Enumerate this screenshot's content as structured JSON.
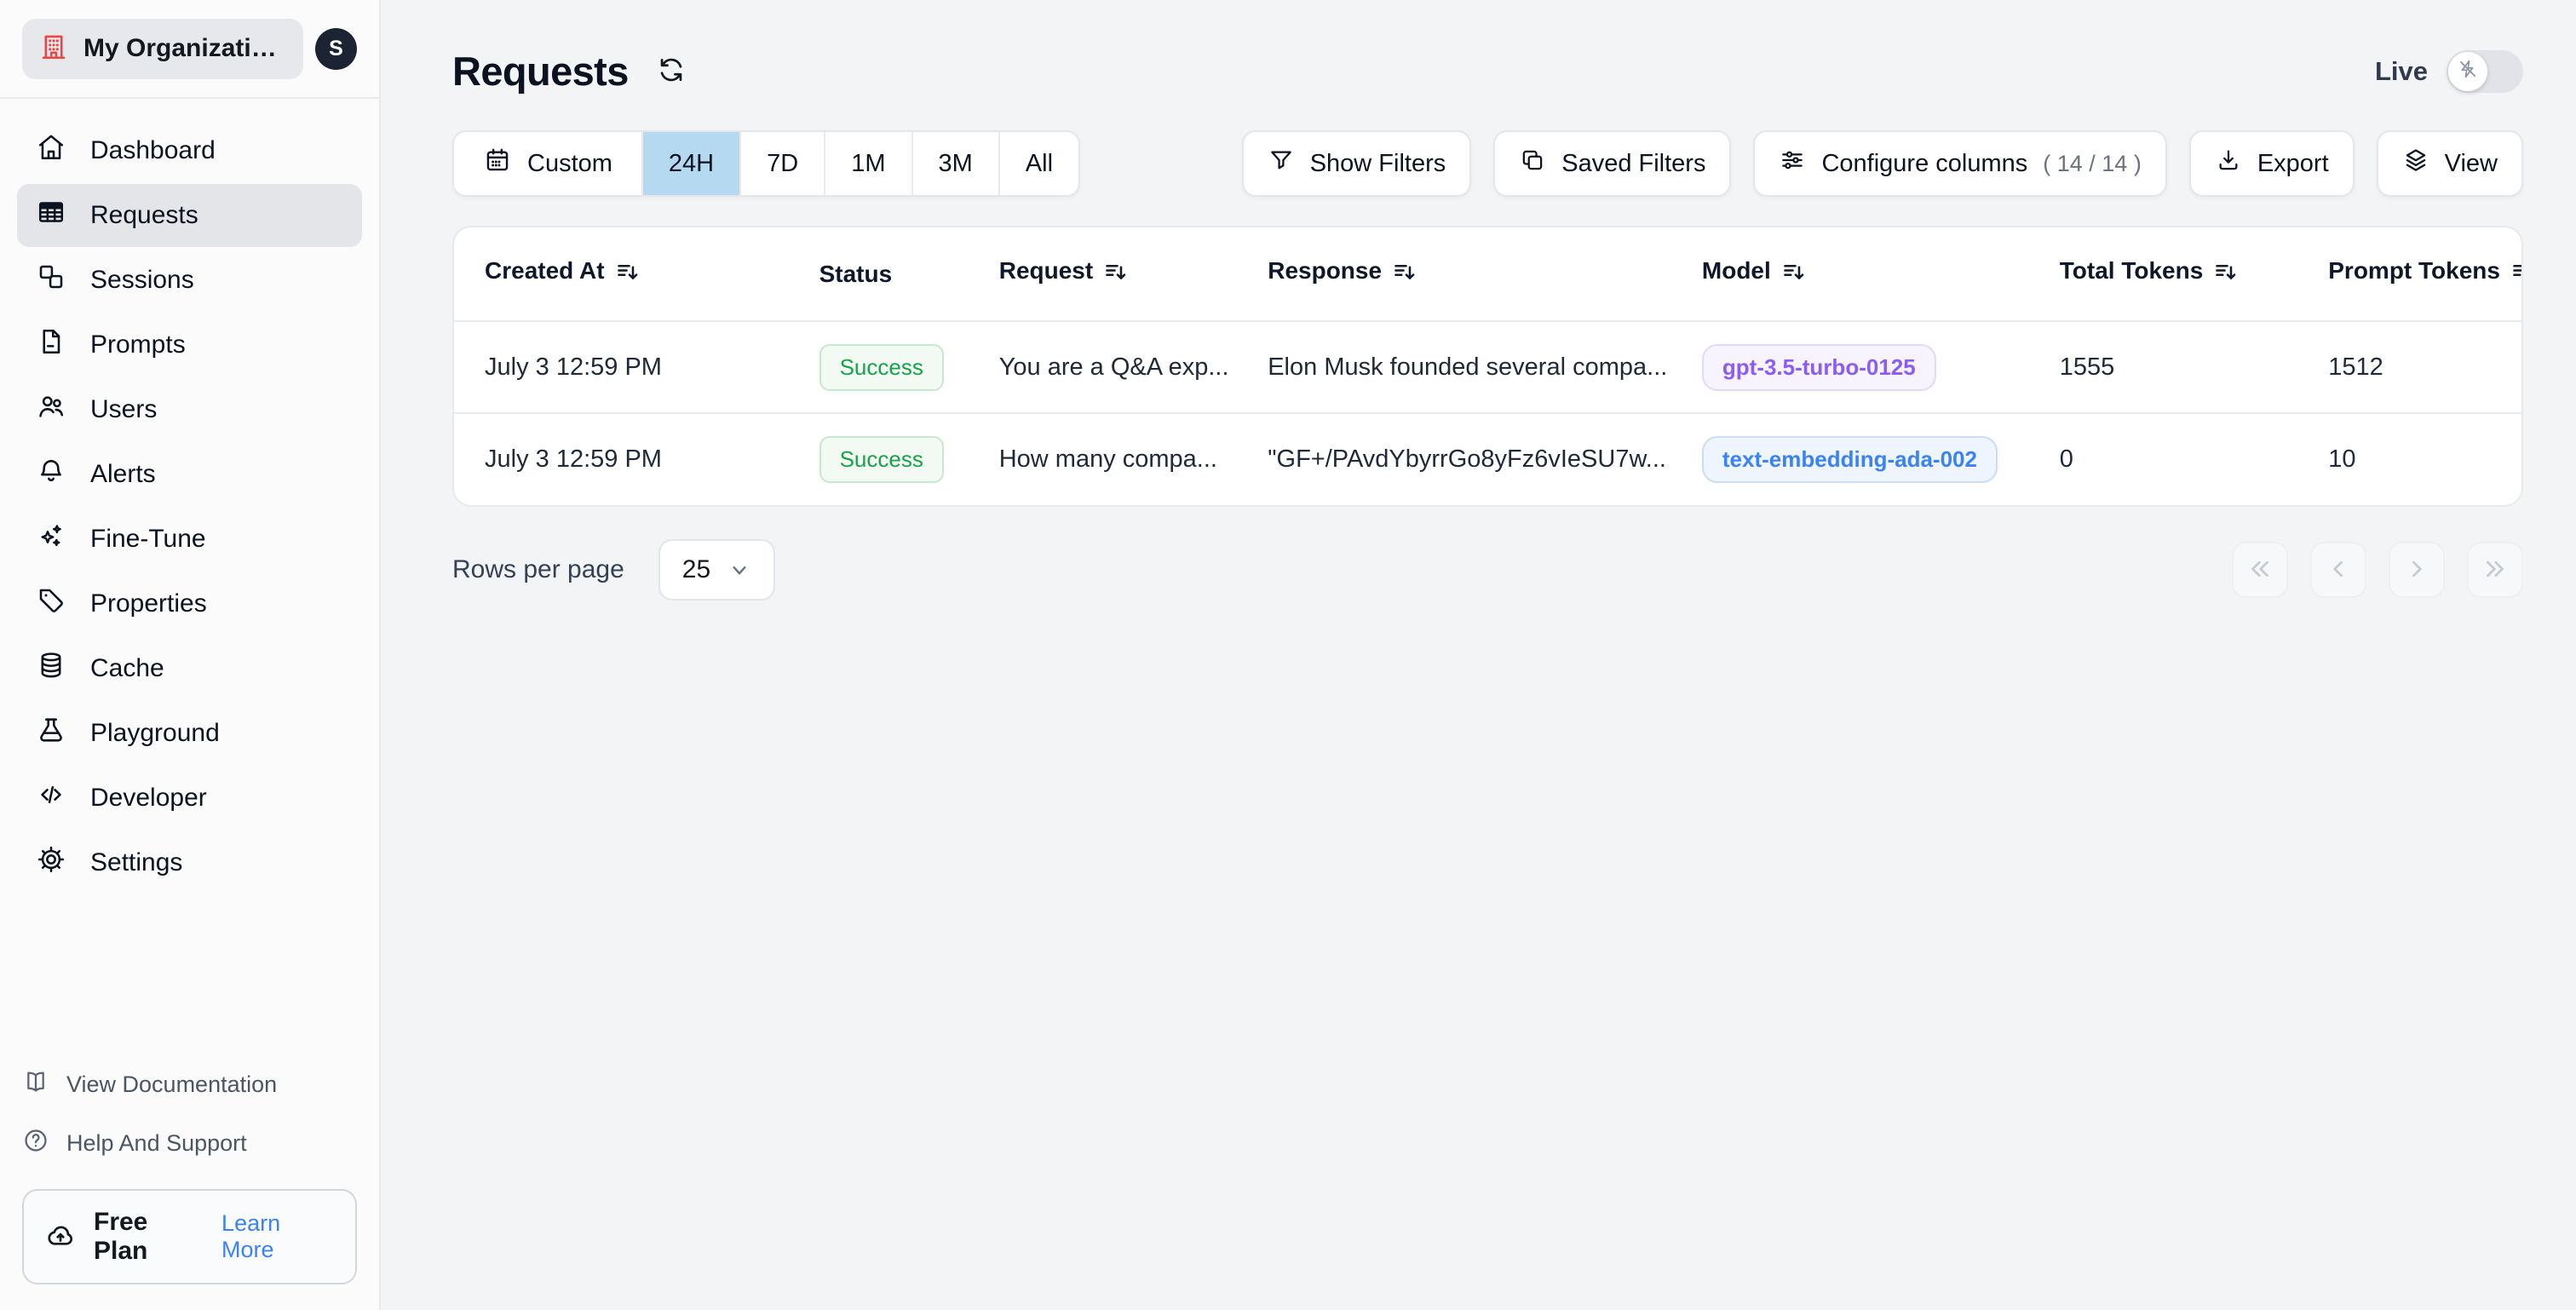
{
  "org": {
    "name": "My Organizatio...",
    "avatar_initial": "S"
  },
  "sidebar": {
    "items": [
      {
        "label": "Dashboard",
        "icon": "home-icon",
        "active": false
      },
      {
        "label": "Requests",
        "icon": "table-icon",
        "active": true
      },
      {
        "label": "Sessions",
        "icon": "sessions-icon",
        "active": false
      },
      {
        "label": "Prompts",
        "icon": "document-icon",
        "active": false
      },
      {
        "label": "Users",
        "icon": "users-icon",
        "active": false
      },
      {
        "label": "Alerts",
        "icon": "bell-icon",
        "active": false
      },
      {
        "label": "Fine-Tune",
        "icon": "sparkles-icon",
        "active": false
      },
      {
        "label": "Properties",
        "icon": "tag-icon",
        "active": false
      },
      {
        "label": "Cache",
        "icon": "database-icon",
        "active": false
      },
      {
        "label": "Playground",
        "icon": "flask-icon",
        "active": false
      },
      {
        "label": "Developer",
        "icon": "code-icon",
        "active": false
      },
      {
        "label": "Settings",
        "icon": "gear-icon",
        "active": false
      }
    ],
    "footer_links": [
      {
        "label": "View Documentation",
        "icon": "book-open-icon"
      },
      {
        "label": "Help And Support",
        "icon": "help-circle-icon"
      }
    ],
    "plan": {
      "label": "Free Plan",
      "action": "Learn More",
      "icon": "cloud-upload-icon"
    }
  },
  "header": {
    "title": "Requests",
    "live_label": "Live",
    "live_on": false
  },
  "toolbar": {
    "time_ranges": [
      {
        "label": "Custom",
        "selected": false
      },
      {
        "label": "24H",
        "selected": true
      },
      {
        "label": "7D",
        "selected": false
      },
      {
        "label": "1M",
        "selected": false
      },
      {
        "label": "3M",
        "selected": false
      },
      {
        "label": "All",
        "selected": false
      }
    ],
    "buttons": {
      "show_filters": "Show Filters",
      "saved_filters": "Saved Filters",
      "configure_columns": "Configure columns",
      "configure_columns_count": "( 14 / 14 )",
      "export": "Export",
      "view": "View"
    }
  },
  "table": {
    "columns": [
      {
        "label": "Created At",
        "sortable": true
      },
      {
        "label": "Status",
        "sortable": false
      },
      {
        "label": "Request",
        "sortable": true
      },
      {
        "label": "Response",
        "sortable": true
      },
      {
        "label": "Model",
        "sortable": true
      },
      {
        "label": "Total Tokens",
        "sortable": true
      },
      {
        "label": "Prompt Tokens",
        "sortable": true
      }
    ],
    "rows": [
      {
        "created_at": "July 3 12:59 PM",
        "status": "Success",
        "request": "You are a Q&A exp...",
        "response": "Elon Musk founded several compa...",
        "model": "gpt-3.5-turbo-0125",
        "model_color": "purple",
        "total_tokens": "1555",
        "prompt_tokens": "1512"
      },
      {
        "created_at": "July 3 12:59 PM",
        "status": "Success",
        "request": "How many compa...",
        "response": "\"GF+/PAvdYbyrrGo8yFz6vIeSU7w...",
        "model": "text-embedding-ada-002",
        "model_color": "blue",
        "total_tokens": "0",
        "prompt_tokens": "10"
      }
    ]
  },
  "pagination": {
    "rows_per_page_label": "Rows per page",
    "rows_per_page_value": "25"
  },
  "colors": {
    "accent_blue": "#3b82f6",
    "selected_range_bg": "#b5d9f1",
    "success_green": "#16a34a",
    "model_purple": "#8b5cf6",
    "model_blue": "#3b82f6",
    "logo_red": "#ef4444"
  }
}
